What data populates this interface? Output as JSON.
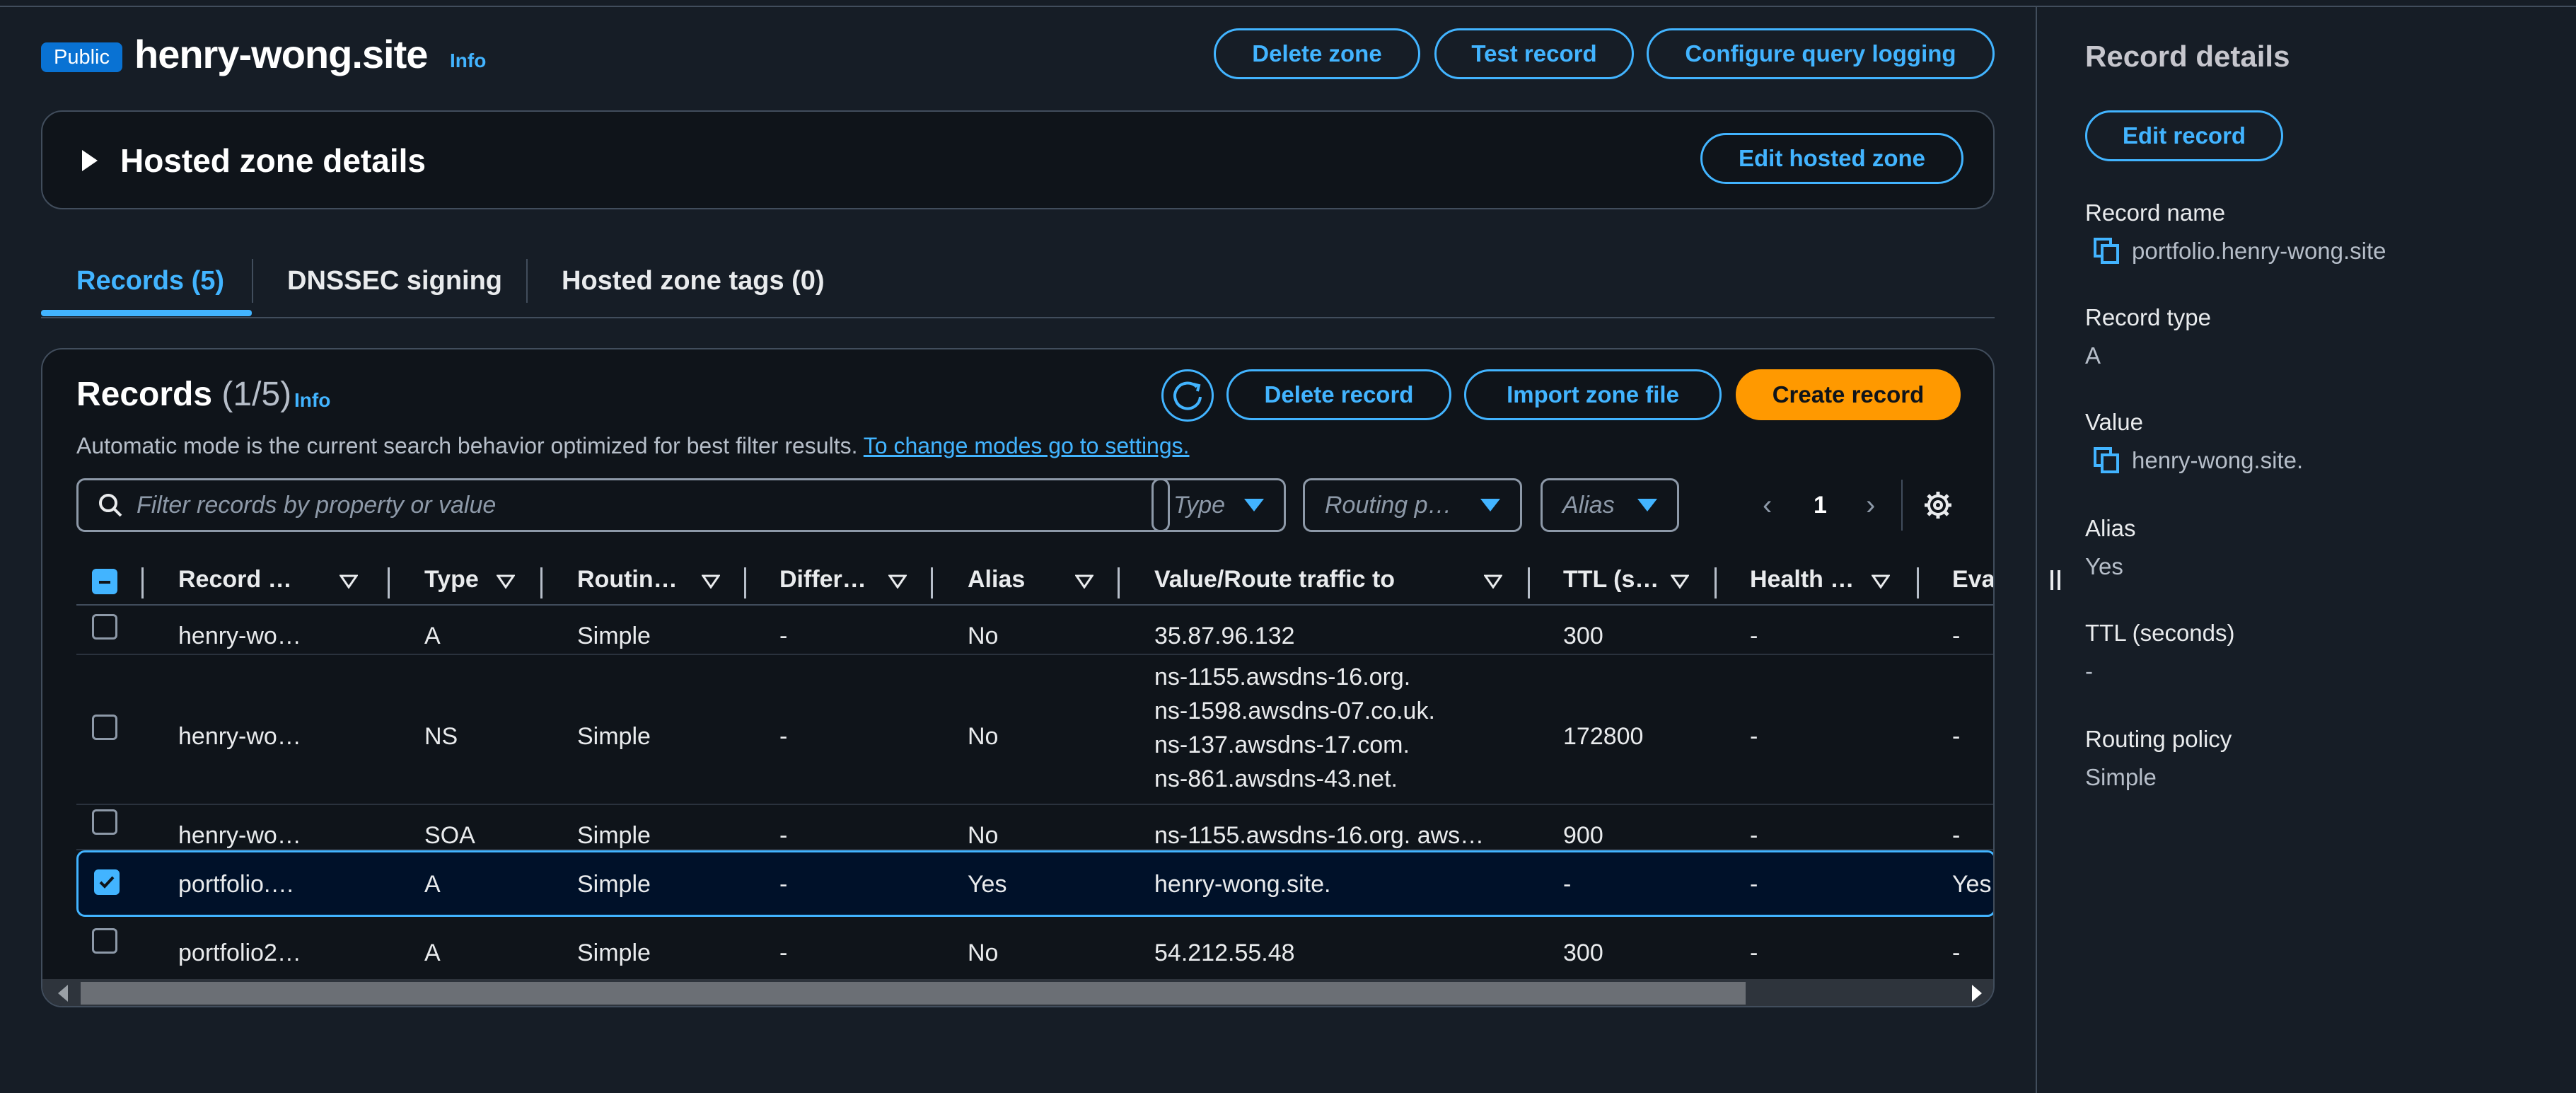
{
  "header": {
    "badge": "Public",
    "zone_name": "henry-wong.site",
    "info": "Info",
    "buttons": {
      "delete_zone": "Delete zone",
      "test_record": "Test record",
      "configure_logging": "Configure query logging"
    }
  },
  "hosted_zone_panel": {
    "title": "Hosted zone details",
    "edit_button": "Edit hosted zone"
  },
  "tabs": [
    {
      "label": "Records (5)",
      "active": true
    },
    {
      "label": "DNSSEC signing",
      "active": false
    },
    {
      "label": "Hosted zone tags (0)",
      "active": false
    }
  ],
  "records": {
    "title": "Records",
    "count": "(1/5)",
    "info": "Info",
    "description": "Automatic mode is the current search behavior optimized for best filter results.",
    "settings_link": "To change modes go to settings.",
    "buttons": {
      "delete": "Delete record",
      "import": "Import zone file",
      "create": "Create record"
    },
    "search_placeholder": "Filter records by property or value",
    "filters": {
      "type": "Type",
      "routing": "Routing p…",
      "alias": "Alias"
    },
    "page": "1",
    "columns": [
      "Record …",
      "Type",
      "Routin…",
      "Differ…",
      "Alias",
      "Value/Route traffic to",
      "TTL (s…",
      "Health …",
      "Evalua…"
    ],
    "rows": [
      {
        "name": "henry-wo…",
        "type": "A",
        "routing": "Simple",
        "differ": "-",
        "alias": "No",
        "value": [
          "35.87.96.132"
        ],
        "ttl": "300",
        "health": "-",
        "eval": "-",
        "checked": false
      },
      {
        "name": "henry-wo…",
        "type": "NS",
        "routing": "Simple",
        "differ": "-",
        "alias": "No",
        "value": [
          "ns-1155.awsdns-16.org.",
          "ns-1598.awsdns-07.co.uk.",
          "ns-137.awsdns-17.com.",
          "ns-861.awsdns-43.net."
        ],
        "ttl": "172800",
        "health": "-",
        "eval": "-",
        "checked": false
      },
      {
        "name": "henry-wo…",
        "type": "SOA",
        "routing": "Simple",
        "differ": "-",
        "alias": "No",
        "value": [
          "ns-1155.awsdns-16.org. aws…"
        ],
        "ttl": "900",
        "health": "-",
        "eval": "-",
        "checked": false
      },
      {
        "name": "portfolio.…",
        "type": "A",
        "routing": "Simple",
        "differ": "-",
        "alias": "Yes",
        "value": [
          "henry-wong.site."
        ],
        "ttl": "-",
        "health": "-",
        "eval": "Yes",
        "checked": true
      },
      {
        "name": "portfolio2…",
        "type": "A",
        "routing": "Simple",
        "differ": "-",
        "alias": "No",
        "value": [
          "54.212.55.48"
        ],
        "ttl": "300",
        "health": "-",
        "eval": "-",
        "checked": false
      }
    ]
  },
  "details": {
    "title": "Record details",
    "edit_button": "Edit record",
    "record_name_label": "Record name",
    "record_name": "portfolio.henry-wong.site",
    "record_type_label": "Record type",
    "record_type": "A",
    "value_label": "Value",
    "value": "henry-wong.site.",
    "alias_label": "Alias",
    "alias": "Yes",
    "ttl_label": "TTL (seconds)",
    "ttl": "-",
    "routing_label": "Routing policy",
    "routing": "Simple"
  },
  "colors": {
    "accent": "#42b4ff",
    "primary": "#ff9900",
    "badge": "#0972d3",
    "background": "#161d26"
  }
}
